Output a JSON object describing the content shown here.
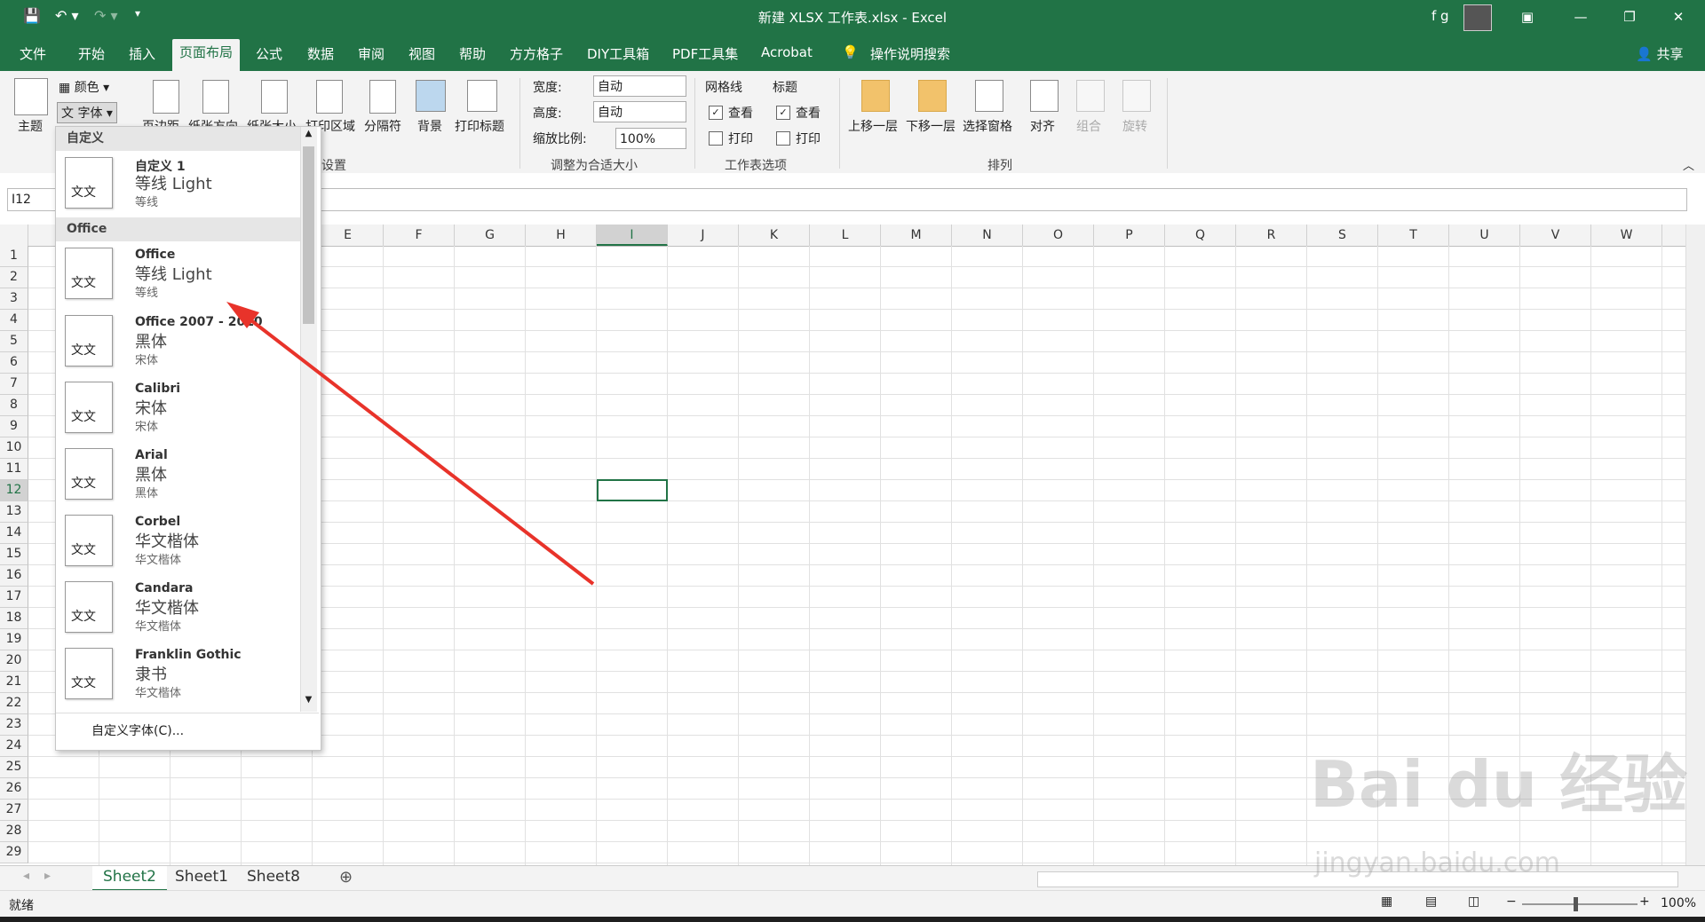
{
  "titlebar": {
    "title": "新建 XLSX 工作表.xlsx  -  Excel",
    "user": "f g",
    "accent": "#217346"
  },
  "tabs": [
    "文件",
    "开始",
    "插入",
    "页面布局",
    "公式",
    "数据",
    "审阅",
    "视图",
    "帮助",
    "方方格子",
    "DIY工具箱",
    "PDF工具集",
    "Acrobat"
  ],
  "tell_me": "操作说明搜索",
  "share": "共享",
  "ribbon": {
    "theme": "主题",
    "colors": "颜色",
    "fonts": "字体",
    "margins": "页边距",
    "orientation": "纸张方向",
    "size": "纸张大小",
    "print_area": "打印区域",
    "breaks": "分隔符",
    "background": "背景",
    "print_titles": "打印标题",
    "page_setup_group": "设置",
    "width_label": "宽度:",
    "width_value": "自动",
    "height_label": "高度:",
    "height_value": "自动",
    "scale_label": "缩放比例:",
    "scale_value": "100%",
    "scale_group": "调整为合适大小",
    "gridlines": "网格线",
    "headings": "标题",
    "view": "查看",
    "print": "打印",
    "sheet_options_group": "工作表选项",
    "bring_forward": "上移一层",
    "send_backward": "下移一层",
    "selection_pane": "选择窗格",
    "align": "对齐",
    "group": "组合",
    "rotate": "旋转",
    "arrange_group": "排列"
  },
  "namebox": "I12",
  "columns": [
    "E",
    "F",
    "G",
    "H",
    "I",
    "J",
    "K",
    "L",
    "M",
    "N",
    "O",
    "P",
    "Q",
    "R",
    "S",
    "T",
    "U",
    "V",
    "W"
  ],
  "rows": [
    "1",
    "2",
    "3",
    "4",
    "5",
    "6",
    "7",
    "8",
    "9",
    "10",
    "11",
    "12",
    "13",
    "14",
    "15",
    "16",
    "17",
    "18",
    "19",
    "20",
    "21",
    "22",
    "23",
    "24",
    "25",
    "26",
    "27",
    "28",
    "29"
  ],
  "selected_column": "I",
  "selected_row": "12",
  "sheets": [
    "Sheet2",
    "Sheet1",
    "Sheet8"
  ],
  "status": "就绪",
  "zoom": "100%",
  "fonts_dropdown": {
    "custom_header": "自定义",
    "office_header": "Office",
    "items": [
      {
        "name": "自定义 1",
        "major": "等线 Light",
        "minor": "等线"
      },
      {
        "name": "Office",
        "major": "等线 Light",
        "minor": "等线"
      },
      {
        "name": "Office 2007 - 2010",
        "major": "黑体",
        "minor": "宋体"
      },
      {
        "name": "Calibri",
        "major": "宋体",
        "minor": "宋体"
      },
      {
        "name": "Arial",
        "major": "黑体",
        "minor": "黑体"
      },
      {
        "name": "Corbel",
        "major": "华文楷体",
        "minor": "华文楷体"
      },
      {
        "name": "Candara",
        "major": "华文楷体",
        "minor": "华文楷体"
      },
      {
        "name": "Franklin Gothic",
        "major": "隶书",
        "minor": "华文楷体"
      }
    ],
    "thumb_text": "文文",
    "customize": "自定义字体(C)..."
  },
  "watermark": "Bai du 经验",
  "watermark_url": "jingyan.baidu.com"
}
